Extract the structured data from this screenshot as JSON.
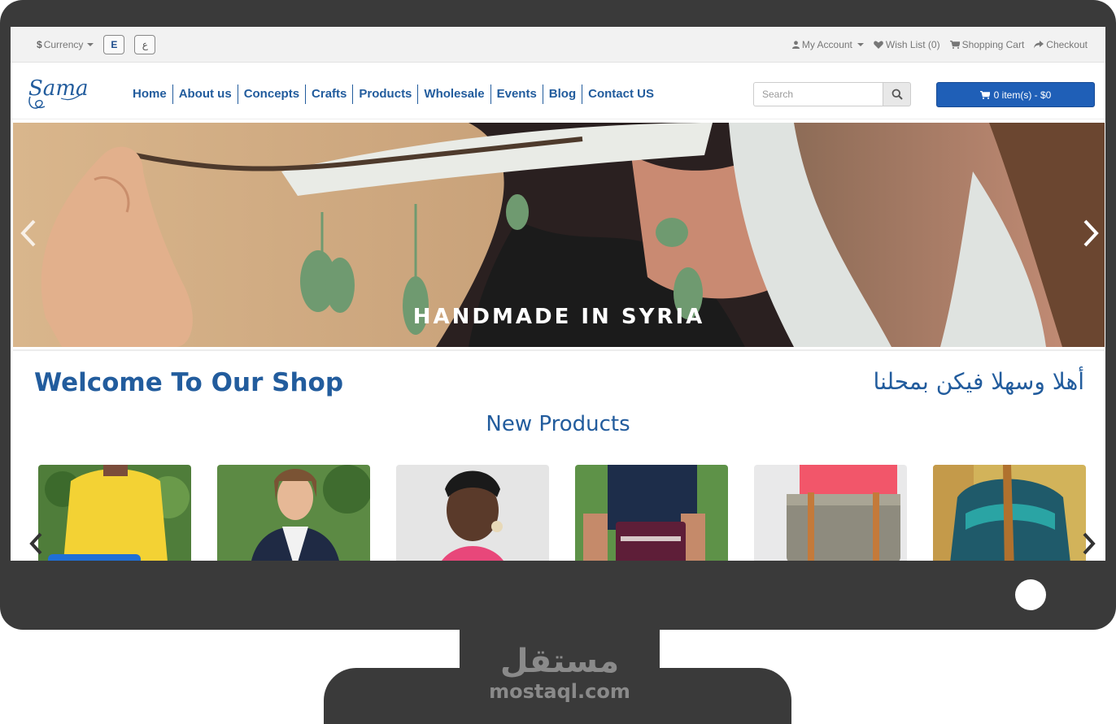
{
  "topbar": {
    "currency_symbol": "$",
    "currency_label": "Currency",
    "lang_en": "E",
    "lang_ar": "ع",
    "my_account": "My Account",
    "wish_list": "Wish List (0)",
    "shopping_cart": "Shopping Cart",
    "checkout": "Checkout"
  },
  "header": {
    "logo_text": "Sama",
    "nav": [
      "Home",
      "About us",
      "Concepts",
      "Crafts",
      "Products",
      "Wholesale",
      "Events",
      "Blog",
      "Contact US"
    ],
    "search_placeholder": "Search",
    "cart_label": "0 item(s) - $0"
  },
  "banner": {
    "caption": "HANDMADE IN SYRIA"
  },
  "welcome": {
    "title_en": "Welcome To Our Shop",
    "title_ar": "أهلا وسهلا فيكن بمحلنا"
  },
  "new_products": {
    "title": "New Products"
  },
  "watermark": {
    "arabic": "مستقل",
    "latin": "mostaql.com"
  },
  "colors": {
    "brand_blue": "#225c9d",
    "cart_button": "#1f5fb7",
    "monitor_frame": "#3a3a3a"
  },
  "icons": [
    "user-icon",
    "heart-icon",
    "cart-icon",
    "share-icon",
    "search-icon",
    "chevron-left-icon",
    "chevron-right-icon"
  ]
}
